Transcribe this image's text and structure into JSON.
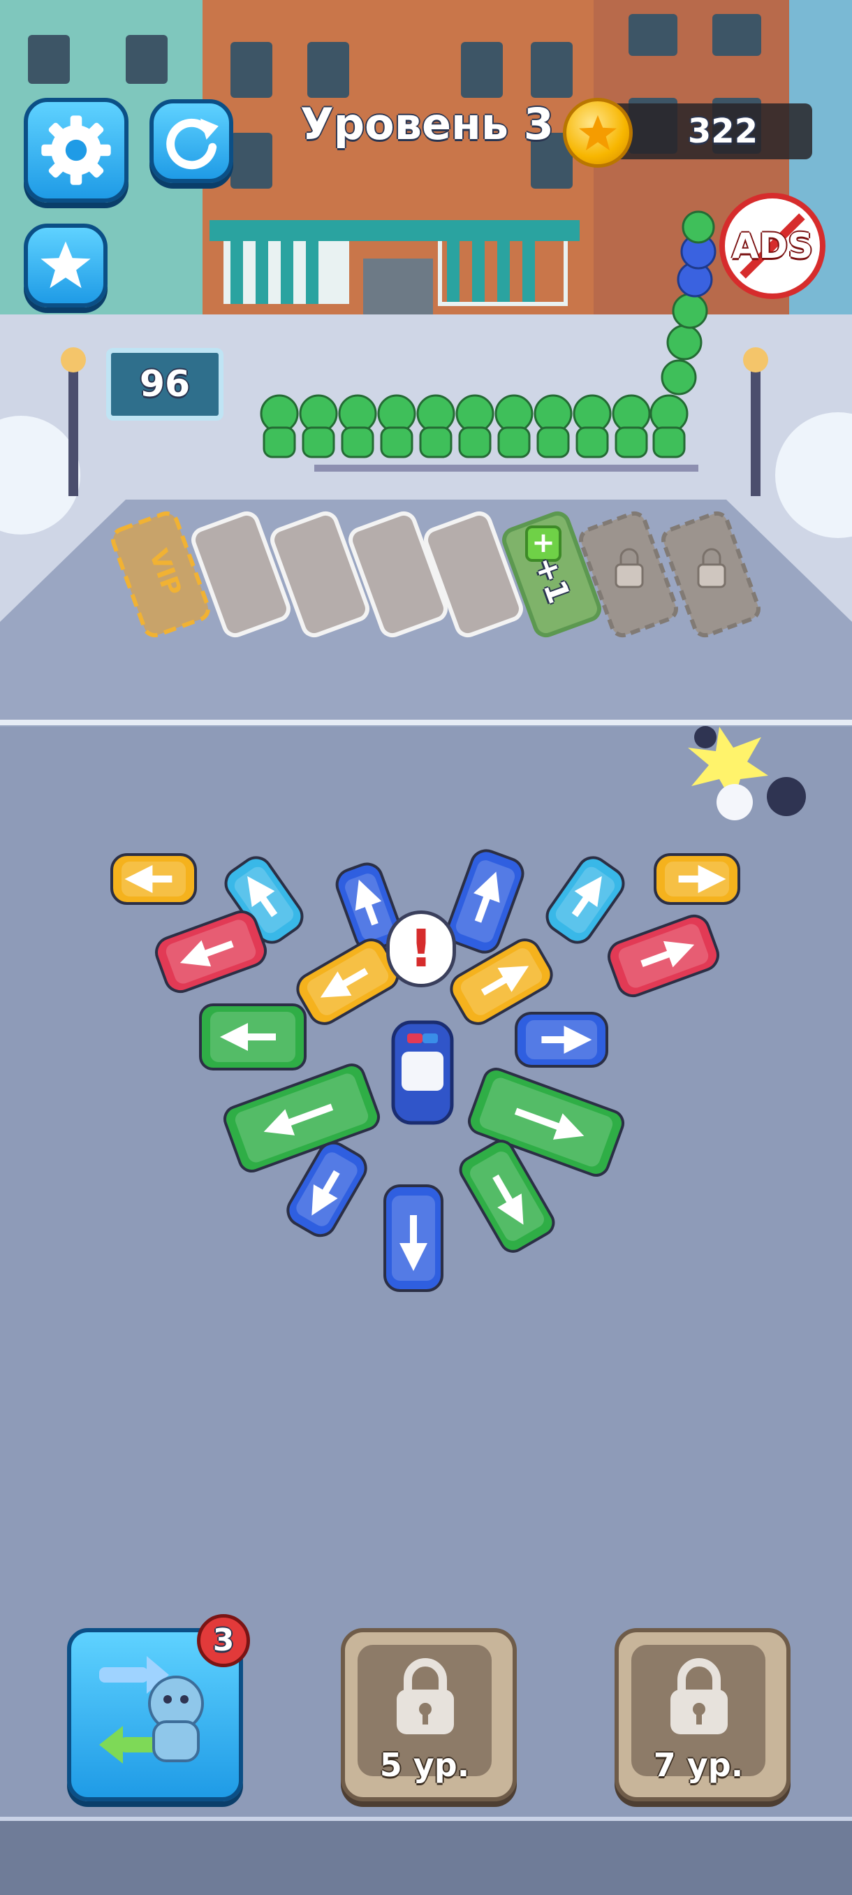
{
  "hud": {
    "level_label": "Уровень 3",
    "coins": "322",
    "ads_label": "ADS"
  },
  "parking": {
    "counter": "96",
    "vip_label": "VIP",
    "plus_label": "+1",
    "slots": [
      "vip",
      "empty",
      "empty",
      "empty",
      "empty",
      "plus",
      "locked",
      "locked"
    ]
  },
  "boosters": {
    "swap_badge": "3",
    "lock1_label": "5 ур.",
    "lock2_label": "7 ур."
  },
  "colors": {
    "accent_blue": "#1f9be6",
    "bus_green": "#2fae46",
    "car_blue": "#2f5fe0",
    "car_yellow": "#f5b21d",
    "car_red": "#e23a55",
    "car_cyan": "#39b8e8",
    "alert_red": "#d62c2c"
  },
  "icons": [
    "gear-icon",
    "restart-icon",
    "star-icon",
    "coin-icon",
    "no-ads-icon",
    "lock-icon",
    "swap-passenger-icon",
    "exclamation-icon"
  ]
}
